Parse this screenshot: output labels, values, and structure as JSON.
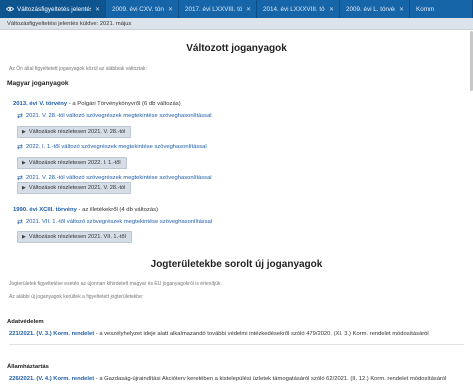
{
  "tabs": [
    {
      "label": "Változásfigyeltetés jelentések",
      "active": true
    },
    {
      "label": "2009. évi CXV. törvény",
      "active": false
    },
    {
      "label": "2017. évi LXXVIII. törvény",
      "active": false
    },
    {
      "label": "2014. évi LXXXVIII. törvény",
      "active": false
    },
    {
      "label": "2009. évi L. törvény",
      "active": false
    },
    {
      "label": "Komm",
      "active": false
    }
  ],
  "subheader": "Változásfigyeltetési jelentés küldve: 2021. május",
  "section1": {
    "title": "Változott joganyagok",
    "intro": "Az Ön által figyeltetett joganyagok közül az alábbiak változtak:",
    "category": "Magyar joganyagok",
    "laws": [
      {
        "ref": "2013. évi V. törvény",
        "desc": " - a Polgári Törvénykönyvről (6 db változás)",
        "changes": [
          {
            "text": "2021. V. 28.-tól változó szövegrészek megtekintése szöveghasonlítással",
            "button": "Változások részletesen 2021. V. 28.-tól"
          },
          {
            "text": "2022. I. 1.-től változó szövegrészek megtekintése szöveghasonlítással",
            "button": "Változások részletesen 2022. I. 1.-től"
          },
          {
            "text": "2021. V. 28.-tól változó szövegrészek megtekintése szöveghasonlítással",
            "button": "Változások részletesen 2021. V. 28.-tól"
          }
        ]
      },
      {
        "ref": "1990. évi XCIII. törvény",
        "desc": " - az illetékekről (4 db változás)",
        "changes": [
          {
            "text": "2021. VII. 1.-től változó szövegrészek megtekintése szöveghasonlítással",
            "button": "Változások részletesen 2021. VII. 1.-től"
          }
        ]
      }
    ]
  },
  "section2": {
    "title": "Jogterületekbe sorolt új joganyagok",
    "intro1": "Jogterületek figyeltetése esetén az újonnan kihirdetett magyar és EU joganyagokról is értesítjük.",
    "intro2": "Az alábbi új joganyagok kerültek a figyeltetett jogterületekbe:",
    "groups": [
      {
        "name": "Adatvédelem",
        "ref": "221/2021. (V. 3.) Korm. rendelet",
        "desc": " - a veszélyhelyzet ideje alatt alkalmazandó további védelmi intézkedésekről szóló 479/2020. (XI. 3.) Korm. rendelet módosításáról"
      },
      {
        "name": "Államháztartás",
        "ref": "226/2021. (V. 4.) Korm. rendelet",
        "desc": " - a Gazdaság-újraindítási Akcióterv keretében a kistelepülési üzletek támogatásáról szóló 62/2021. (II. 12.) Korm. rendelet módosításáról"
      }
    ]
  }
}
